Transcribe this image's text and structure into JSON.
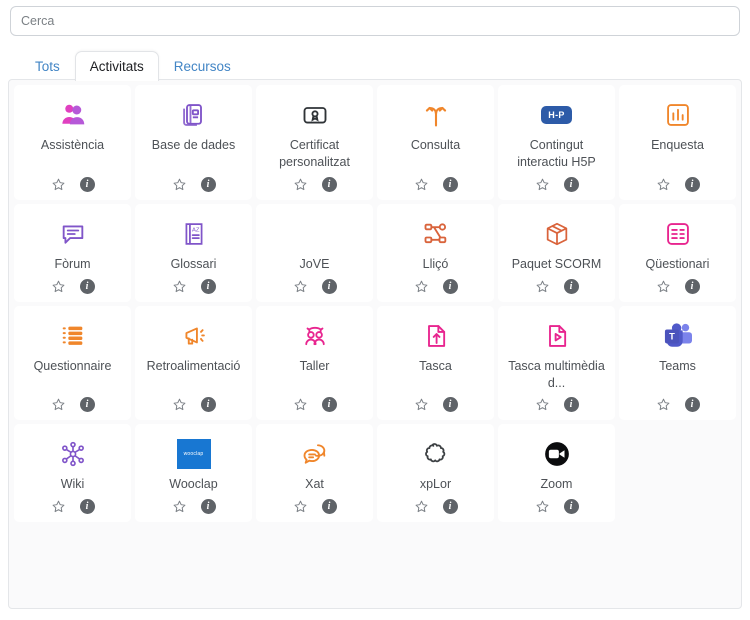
{
  "search": {
    "placeholder": "Cerca",
    "value": ""
  },
  "tabs": [
    {
      "label": "Tots",
      "active": false
    },
    {
      "label": "Activitats",
      "active": true
    },
    {
      "label": "Recursos",
      "active": false
    }
  ],
  "actions": {
    "favourite_label": "☆",
    "info_label": "i"
  },
  "colors": {
    "accent_tab": "#4285c5",
    "purple": "#8055c9",
    "magenta": "#e8258f",
    "orange": "#f0862b",
    "dark": "#2f3337",
    "h5p_blue": "#2d5ba8",
    "teams_blue": "#5059c9",
    "wooclap_blue": "#1877d2",
    "panel_bg": "#fafafb",
    "card_bg": "#ffffff",
    "label_text": "#4d5156"
  },
  "grid": {
    "columns": 6,
    "items": [
      {
        "label": "Assistència",
        "icon": "attendance-people-icon"
      },
      {
        "label": "Base de dades",
        "icon": "database-pages-icon"
      },
      {
        "label": "Certificat personalitzat",
        "icon": "certificate-badge-icon"
      },
      {
        "label": "Consulta",
        "icon": "choice-fork-icon"
      },
      {
        "label": "Contingut interactiu H5P",
        "icon": "h5p-badge-icon"
      },
      {
        "label": "Enquesta",
        "icon": "survey-barchart-icon"
      },
      {
        "label": "Fòrum",
        "icon": "forum-speech-bubble-icon"
      },
      {
        "label": "Glossari",
        "icon": "glossary-book-icon"
      },
      {
        "label": "JoVE",
        "icon": "jove-blank-icon"
      },
      {
        "label": "Lliçó",
        "icon": "lesson-nodes-icon"
      },
      {
        "label": "Paquet SCORM",
        "icon": "scorm-box-icon"
      },
      {
        "label": "Qüestionari",
        "icon": "quiz-checklist-icon"
      },
      {
        "label": "Questionnaire",
        "icon": "questionnaire-list-icon"
      },
      {
        "label": "Retroalimentació",
        "icon": "feedback-megaphone-icon"
      },
      {
        "label": "Taller",
        "icon": "workshop-people-icon"
      },
      {
        "label": "Tasca",
        "icon": "assignment-upload-icon"
      },
      {
        "label": "Tasca multimèdia d...",
        "icon": "media-assignment-play-icon"
      },
      {
        "label": "Teams",
        "icon": "microsoft-teams-icon"
      },
      {
        "label": "Wiki",
        "icon": "wiki-network-icon"
      },
      {
        "label": "Wooclap",
        "icon": "wooclap-logo-icon"
      },
      {
        "label": "Xat",
        "icon": "chat-bubbles-icon"
      },
      {
        "label": "xpLor",
        "icon": "xplor-cloud-icon"
      },
      {
        "label": "Zoom",
        "icon": "zoom-camera-icon"
      },
      {
        "label": "",
        "icon": "empty-slot"
      }
    ]
  }
}
